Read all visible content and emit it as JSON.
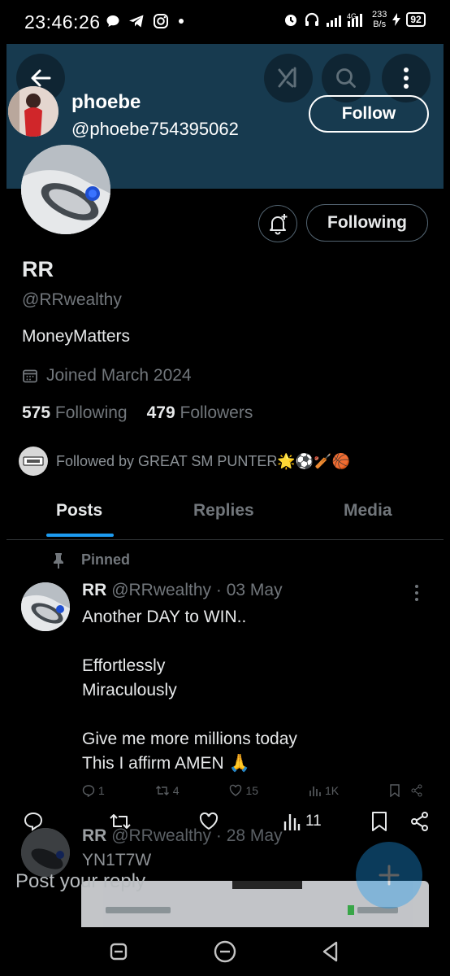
{
  "status_bar": {
    "time": "23:46:26",
    "net_speed_value": "233",
    "net_speed_unit": "B/s",
    "network_type": "4G",
    "battery": "92"
  },
  "header": {
    "account_name": "phoebe",
    "account_handle": "@phoebe754395062",
    "follow_label": "Follow",
    "bg_color": "#173a4f"
  },
  "profile": {
    "name": "RR",
    "handle": "@RRwealthy",
    "bio": "MoneyMatters",
    "joined": "Joined March 2024",
    "following_count": "575",
    "following_label": "Following",
    "followers_count": "479",
    "followers_label": "Followers",
    "following_button": "Following",
    "followed_by": "Followed by GREAT SM PUNTER🌟⚽🏏🏀"
  },
  "tabs": [
    {
      "label": "Posts",
      "active": true
    },
    {
      "label": "Replies",
      "active": false
    },
    {
      "label": "Media",
      "active": false
    }
  ],
  "posts": [
    {
      "pinned_label": "Pinned",
      "author": "RR",
      "handle_date": "@RRwealthy · 03 May",
      "text": "Another DAY to WIN..\n\nEffortlessly\nMiraculously\n\nGive me more millions today\nThis I affirm AMEN 🙏",
      "metrics": {
        "replies": "1",
        "reposts": "4",
        "likes": "15",
        "views": "1K"
      }
    },
    {
      "author": "RR",
      "handle_date": "@RRwealthy · 28 May",
      "text": "YN1T7W"
    }
  ],
  "action_bar": {
    "views": "11"
  },
  "reply": {
    "placeholder": "Post your reply"
  },
  "colors": {
    "accent": "#1d9bf0",
    "muted": "#71767b",
    "text": "#e7e9ea"
  }
}
